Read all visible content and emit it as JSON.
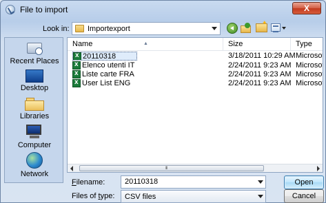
{
  "window": {
    "title": "File to import",
    "close_label": "X"
  },
  "toolbar": {
    "look_in_label": "Look in:",
    "look_in_value": "Importexport"
  },
  "places": [
    {
      "label": "Recent Places",
      "icon": "recent-places-icon"
    },
    {
      "label": "Desktop",
      "icon": "desktop-icon"
    },
    {
      "label": "Libraries",
      "icon": "libraries-icon"
    },
    {
      "label": "Computer",
      "icon": "computer-icon"
    },
    {
      "label": "Network",
      "icon": "network-icon"
    }
  ],
  "filelist": {
    "columns": [
      "Name",
      "Size",
      "Type"
    ],
    "rows": [
      {
        "name": "20110318",
        "size": "3/18/2011 10:29 AM",
        "type": "Microsoft",
        "selected": true
      },
      {
        "name": "Elenco utenti IT",
        "size": "2/24/2011 9:23 AM",
        "type": "Microsoft",
        "selected": false
      },
      {
        "name": "Liste carte FRA",
        "size": "2/24/2011 9:23 AM",
        "type": "Microsoft",
        "selected": false
      },
      {
        "name": "User List ENG",
        "size": "2/24/2011 9:23 AM",
        "type": "Microsoft",
        "selected": false
      }
    ],
    "scroll_grip": "III"
  },
  "footer": {
    "filename_label_u": "F",
    "filename_label_rest": "ilename:",
    "filename_value": "20110318",
    "filetype_label_pre": "Files of ",
    "filetype_label_u": "t",
    "filetype_label_rest": "ype:",
    "filetype_value": "CSV files",
    "open_label": "Open",
    "cancel_label": "Cancel"
  }
}
